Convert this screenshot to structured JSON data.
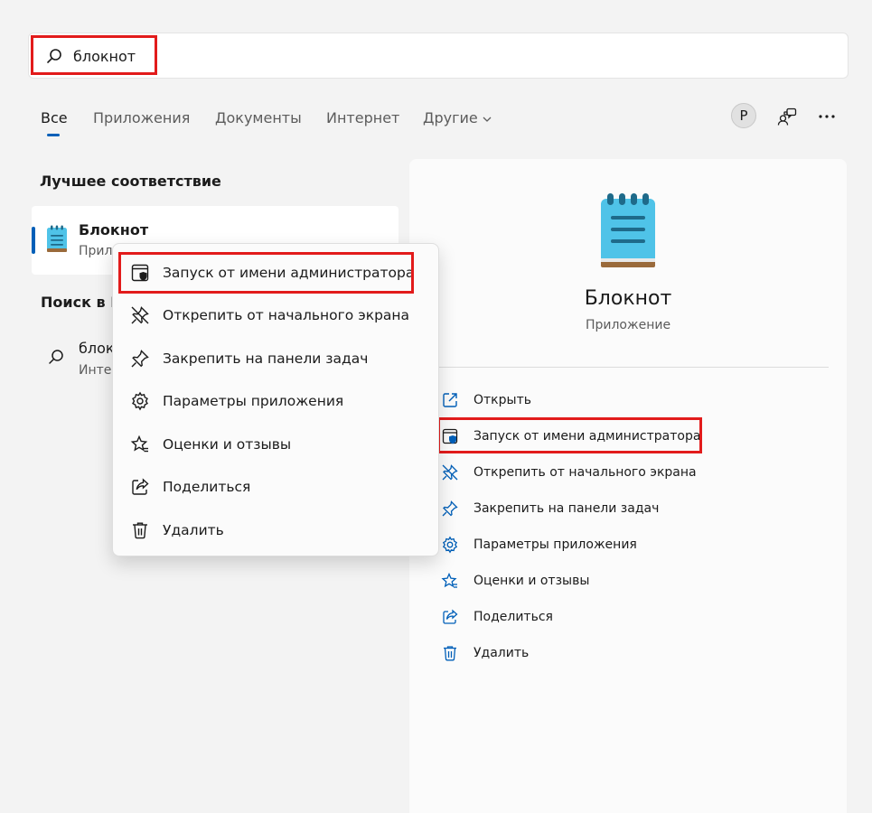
{
  "search": {
    "query": "блокнот"
  },
  "tabs": [
    {
      "label": "Все"
    },
    {
      "label": "Приложения"
    },
    {
      "label": "Документы"
    },
    {
      "label": "Интернет"
    },
    {
      "label": "Другие"
    }
  ],
  "user": {
    "avatar_letter": "P"
  },
  "best_match": {
    "heading": "Лучшее соответствие",
    "title": "Блокнот",
    "subtitle": "Прил"
  },
  "web_search": {
    "heading": "Поиск в И",
    "result_title": "блок",
    "result_subtitle": "Интер"
  },
  "context_menu": {
    "items": [
      {
        "label": "Запуск от имени администратора",
        "icon": "admin-shield-icon"
      },
      {
        "label": "Открепить от начального экрана",
        "icon": "unpin-icon"
      },
      {
        "label": "Закрепить на панели задач",
        "icon": "pin-icon"
      },
      {
        "label": "Параметры приложения",
        "icon": "gear-icon"
      },
      {
        "label": "Оценки и отзывы",
        "icon": "star-icon"
      },
      {
        "label": "Поделиться",
        "icon": "share-icon"
      },
      {
        "label": "Удалить",
        "icon": "trash-icon"
      }
    ]
  },
  "detail": {
    "title": "Блокнот",
    "subtitle": "Приложение",
    "actions": [
      {
        "label": "Открыть",
        "icon": "open-icon"
      },
      {
        "label": "Запуск от имени администратора",
        "icon": "admin-shield-icon"
      },
      {
        "label": "Открепить от начального экрана",
        "icon": "unpin-icon"
      },
      {
        "label": "Закрепить на панели задач",
        "icon": "pin-icon"
      },
      {
        "label": "Параметры приложения",
        "icon": "gear-icon"
      },
      {
        "label": "Оценки и отзывы",
        "icon": "star-icon"
      },
      {
        "label": "Поделиться",
        "icon": "share-icon"
      },
      {
        "label": "Удалить",
        "icon": "trash-icon"
      }
    ]
  },
  "colors": {
    "accent": "#005fb8",
    "highlight": "#e21b1b",
    "notepad_blue": "#4fc3e8",
    "notepad_dark": "#1e6a8a"
  }
}
